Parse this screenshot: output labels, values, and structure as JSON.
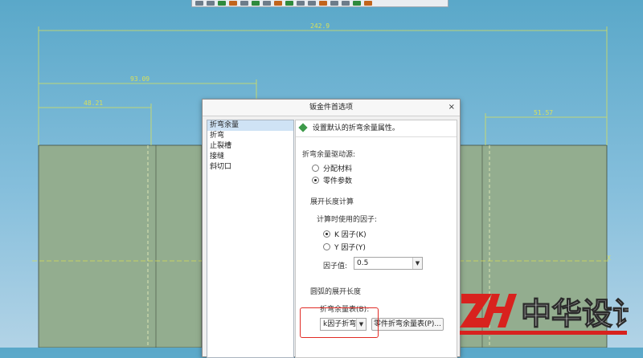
{
  "dimensions": {
    "total": "242.9",
    "left_mid": "93.09",
    "left_short": "48.21",
    "right": "51.57"
  },
  "dialog": {
    "title": "钣金件首选项",
    "close": "×",
    "nav": [
      "折弯余量",
      "折弯",
      "止裂槽",
      "接缝",
      "斜切口"
    ],
    "panel_header": "设置默认的折弯余量属性。",
    "driver_title": "折弯余量驱动源:",
    "driver_options": [
      "分配材料",
      "零件参数"
    ],
    "driver_selected": 1,
    "dev_title": "展开长度计算",
    "factor_title": "计算时使用的因子:",
    "factor_options": [
      "K 因子(K)",
      "Y 因子(Y)"
    ],
    "factor_selected": 0,
    "factor_value_label": "因子值:",
    "factor_value": "0.5",
    "arc_title": "圆弧的展开长度",
    "table_label": "折弯余量表(B):",
    "table_value": "k因子折弯余量",
    "part_table_button": "零件折弯余量表(P)..."
  },
  "watermark": {
    "text": "中华设计",
    "colors": {
      "mark": "#d8221e",
      "text": "#ffffff"
    }
  },
  "colors": {
    "dimension": "#d8e05a",
    "part": "#93ad8f",
    "axis": "#d7dd55"
  }
}
